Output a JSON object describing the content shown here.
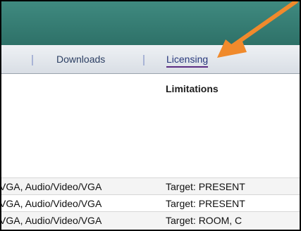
{
  "nav": {
    "items": [
      {
        "label": "Downloads",
        "active": false
      },
      {
        "label": "Licensing",
        "active": true
      }
    ]
  },
  "table": {
    "column_header": "Limitations",
    "rows": [
      {
        "signal": "VGA, Audio/Video/VGA",
        "limitation": "Target: PRESENT"
      },
      {
        "signal": "VGA, Audio/Video/VGA",
        "limitation": "Target: PRESENT"
      },
      {
        "signal": "VGA, Audio/Video/VGA",
        "limitation": "Target: ROOM, C"
      }
    ]
  },
  "colors": {
    "header": "#2e7168",
    "annotation_arrow": "#f08a2c",
    "active_underline": "#5b2b83"
  }
}
